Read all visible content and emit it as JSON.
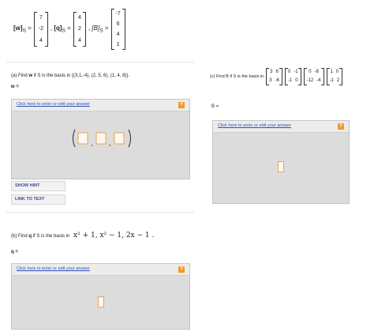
{
  "vectors": {
    "w_label": "[w]",
    "q_label": "[q]",
    "b_label": "[B]",
    "subscript": "S",
    "equals": "=",
    "w_values": [
      "7",
      "-2",
      "4"
    ],
    "q_values": [
      "4",
      "2",
      "4"
    ],
    "b_values": [
      "-7",
      "6",
      "4",
      "1"
    ]
  },
  "part_a": {
    "prefix": "(a) Find",
    "var": "w",
    "text": "if S is the basis in {(3,1,-4), (2, 5, 6), (1, 4, 8)}.",
    "answer_label": "w ="
  },
  "part_c": {
    "prefix": "(c) Find B if S is the basis in",
    "m1": [
      [
        "3",
        "6"
      ],
      [
        "3",
        "-6"
      ]
    ],
    "m2": [
      [
        "0",
        "-1"
      ],
      [
        "-1",
        "0"
      ]
    ],
    "m3": [
      [
        "0",
        "-8"
      ],
      [
        "-12",
        "-4"
      ]
    ],
    "m4": [
      [
        "1",
        "0"
      ],
      [
        "-1",
        "2"
      ]
    ],
    "answer_label": "B ="
  },
  "part_b": {
    "prefix": "(b) Find",
    "var": "q",
    "text": "if S is the basis in",
    "poly": "x² + 1, x² − 1, 2x − 1 .",
    "answer_label": "q ="
  },
  "answer_box": {
    "link_text": "Click here to enter or edit your answer",
    "help_glyph": "?"
  },
  "buttons": {
    "show_hint": "SHOW HINT",
    "link_to_text": "LINK TO TEXT"
  },
  "colors": {
    "link": "#3050b8",
    "help": "#f09a2a",
    "panel": "#dcdcdc"
  }
}
